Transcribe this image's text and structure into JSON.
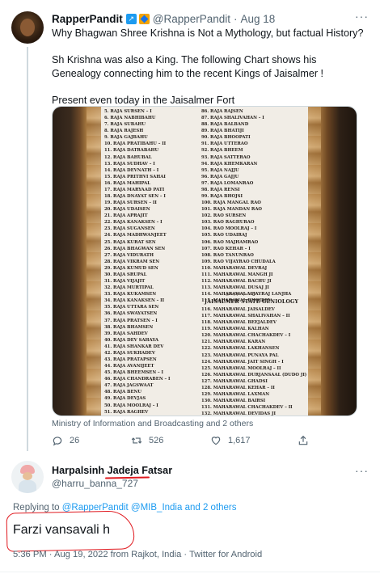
{
  "tweet": {
    "display_name": "RapperPandit",
    "handle": "@RapperPandit",
    "separator": "·",
    "date": "Aug 18",
    "more": "···",
    "text_lines": [
      "Why Bhagwan Shree Krishna is Not a Mythology, but factual History?",
      "Sh Krishna was also a King. The following Chart shows his Genealogy connecting him to the recent Kings of Jaisalmer !",
      "Present even today in the Jaisalmer Fort"
    ],
    "image": {
      "left_column": [
        "5. RAJA SURSEN – I",
        "6. RAJA NABHIBAHU",
        "7. RAJA SUBAHU",
        "8. RAJA RAJESH",
        "9. RAJA GAJBAHU",
        "10. RAJA PRATIBAHU – II",
        "11. RAJA DATRABAHU",
        "12. RAJA BAHUBAL",
        "13. RAJA SUDHAV – I",
        "14. RAJA DEVNATH – I",
        "15. RAJA PRITHVI SAHAI",
        "16. RAJA MAHIPAL",
        "17. RAJA MARYAAD PATI",
        "18. RAJA DNAYAT SEN – I",
        "19. RAJA SURSEN – II",
        "20. RAJA UDAISEN",
        "21. RAJA APRAJIT",
        "22. RAJA KANAKSEN – I",
        "23. RAJA SUGANSEN",
        "24. RAJA MADHWANJEET",
        "25. RAJA KURAT SEN",
        "26. RAJA BHAGWAN SEN",
        "27. RAJA VIDURATH",
        "28. RAJA VIKRAM SEN",
        "29. RAJA KUMUD SEN",
        "30. RAJA SRUPAL",
        "31. RAJA VIJAJIT",
        "32. RAJA MURTIPAL",
        "33. RAJA KUKAMSEN",
        "34. RAJA KANAKSEN – II",
        "35. RAJA UTTARA SEN",
        "36. RAJA SWAYATSEN",
        "37. RAJA PRATSEN – I",
        "38. RAJA BHAMSEN",
        "39. RAJA SAHDEV",
        "40. RAJA DEV SAHAYA",
        "41. RAJA SHANKAR DEV",
        "42. RAJA SUKHADEV",
        "43. RAJA PRATAPSEN",
        "44. RAJA AVANIJEET",
        "45. RAJA BHEEMSEN – I",
        "46. RAJA CHANDRABEN – I",
        "47. RAJA JAGSWAAT",
        "48. RAJA BENU",
        "49. RAJA DEVJAS",
        "50. RAJA MOOLRAJ – I",
        "51. RAJA RAGHEV",
        "52. RAJA SATTURAO",
        "53. RAJA DEVNAND",
        "54. RAJA JAGSHOOP",
        "55. RAJA BUDH",
        "56. RAJA KOHITASH"
      ],
      "right_column": [
        "86. RAJA RAJSEN",
        "87. RAJA SHALIVAHAN – I",
        "88. RAJA BALBAND",
        "89. RAJA BHATIJI",
        "90. RAJA BHOOPATI",
        "91. RAJA UTTERAO",
        "92. RAJA BHEEM",
        "93. RAJA SATTERAO",
        "94. RAJA KHEMKARAN",
        "95. RAJA NAJJU",
        "96. RAJA GAJJU",
        "97. RAJA LOMANRAO",
        "98. RAJA RENSI",
        "99. RAJA BHOJSI",
        "100. RAJA MANGAL RAO",
        "101. RAJA MANDAN RAO",
        "102. RAO SURSEN",
        "103. RAO RAGHURAO",
        "104. RAO MOOLRAJ – I",
        "105. RAO UDAIRAJ",
        "106. RAO MAJHAMRAO",
        "107. RAO KEHAR – I",
        "108. RAO TANUNRAO",
        "109. RAO VIJAYRAO CHUDALA",
        "110. MAHARAWAL DEVRAJ",
        "111. MAHARAWAL MANGH JI",
        "112. MAHARAWAL BACHU JI",
        "113. MAHARAWAL DUSAJ JI",
        "114. MAHARAWAL VIJAYRAJ LANJHA",
        "115. MAHARAWAL BHOJDEV"
      ],
      "signature": "@rapperpandit",
      "state_title": "JAISALMER STATE GENIOLOGY",
      "right_column_lower": [
        "116. MAHARAWAL JAISALDEV",
        "117. MAHARAWAL SHALIVAHAN – II",
        "118. MAHARAWAL BEEJALDEV",
        "119. MAHARAWAL KALHAN",
        "120. MAHARAWAL CHACHAKDEV – I",
        "121. MAHARAWAL KARAN",
        "122. MAHARAWAL LAKHANSEN",
        "123. MAHARAWAL PUNAYA PAL",
        "124. MAHARAWAL JAIT SINGH – I",
        "125. MAHARAWAL MOOLRAJ – II",
        "126. MAHARAWAL DURJANSAAL (DUDO JI)",
        "127. MAHARAWAL GHADSI",
        "128. MAHARAWAL KEHAR – II",
        "129. MAHARAWAL LAXMAN",
        "130. MAHARAWAL BAIRSI",
        "131. MAHARAWAL CHACHAKDEV – II",
        "132. MAHARAWAL DEVIDAS JI",
        "133. MAHARAWAL JAIT SINGH – II",
        "134. MAHARAWAL KARAN SINGH"
      ]
    },
    "image_caption": "Ministry of Information and Broadcasting and 2 others",
    "counts": {
      "replies": "26",
      "retweets": "526",
      "likes": "1,617"
    }
  },
  "reply": {
    "display_name": "Harpalsinh Jadeja Fatsar",
    "handle": "@harru_banna_727",
    "more": "···",
    "replying_prefix": "Replying to ",
    "replying_to": "@RapperPandit @MIB_India and 2 others",
    "text": "Farzi vansavali h",
    "meta": "5:36 PM · Aug 19, 2022 from Rajkot, India · Twitter for Android"
  }
}
